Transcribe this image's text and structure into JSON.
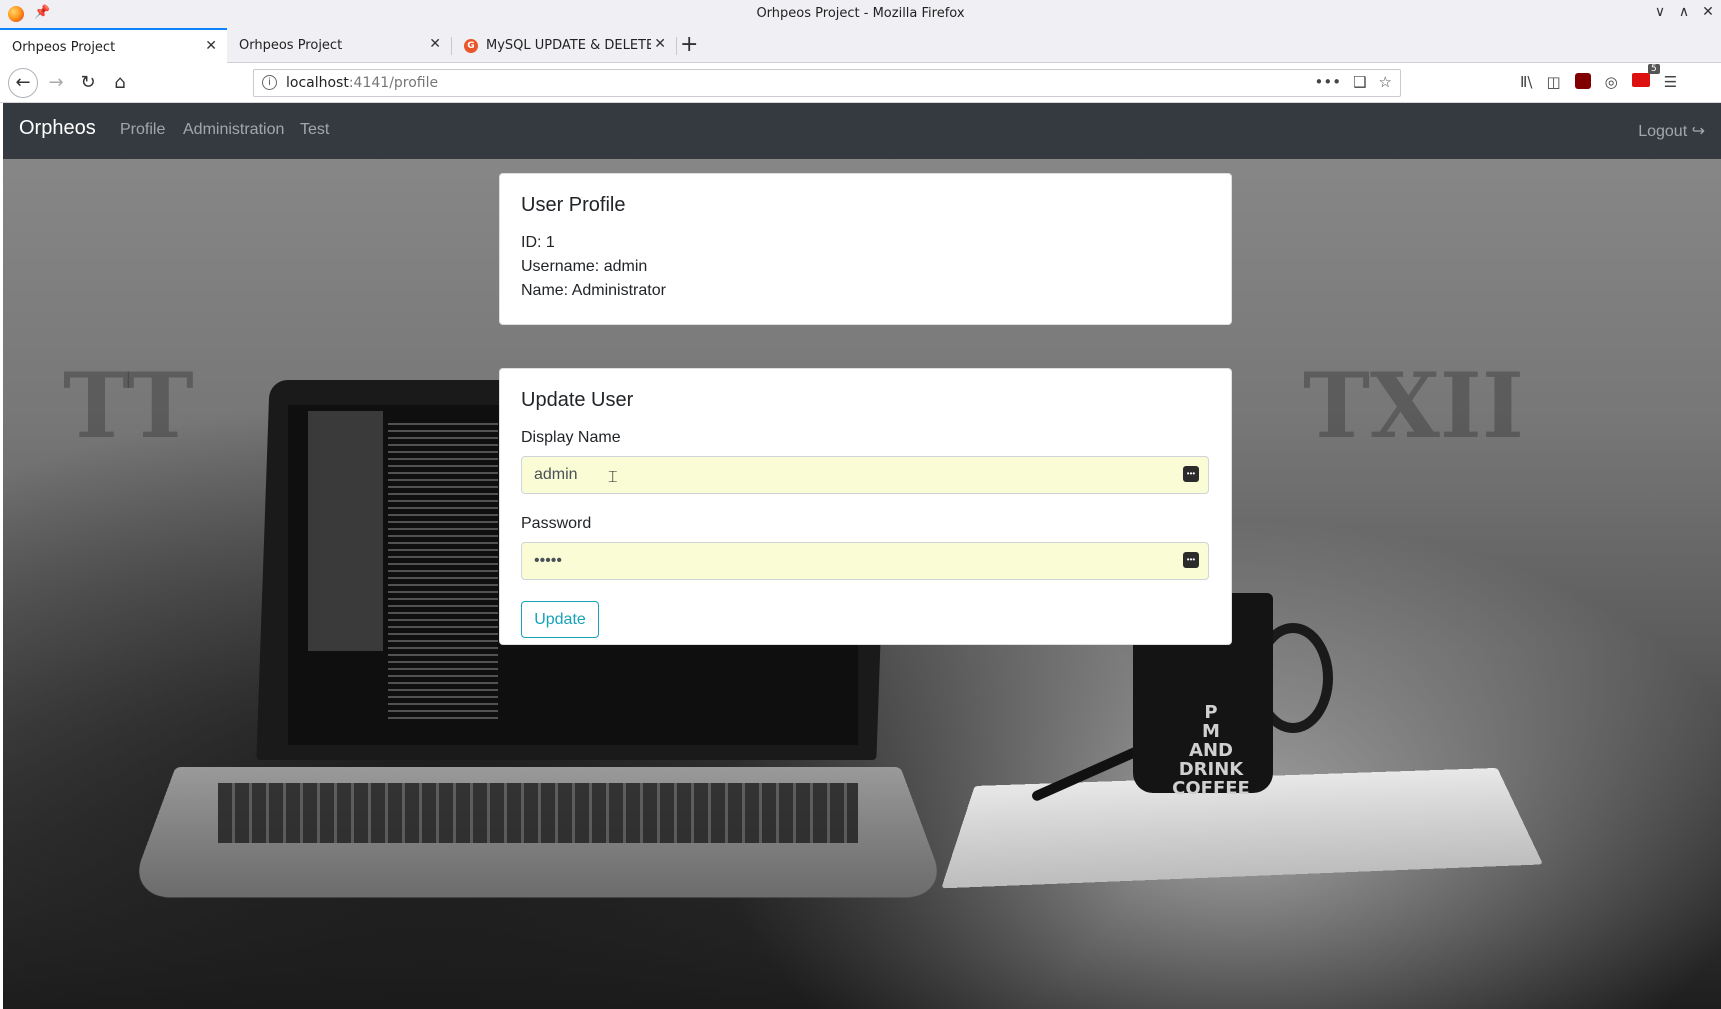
{
  "browser": {
    "window_title": "Orhpeos Project - Mozilla Firefox",
    "tabs": [
      {
        "label": "Orhpeos Project",
        "active": true
      },
      {
        "label": "Orhpeos Project",
        "active": false
      },
      {
        "label": "MySQL UPDATE & DELETE",
        "active": false
      }
    ],
    "url_host": "localhost",
    "url_path": ":4141/profile",
    "extension_badge": "5",
    "icons": {
      "back": "←",
      "forward": "→",
      "reload": "↻",
      "home": "⌂",
      "more": "•••",
      "pocket": "❑",
      "bookmark": "☆",
      "library": "Ⅱ\\",
      "sidebar": "◫",
      "menu": "☰",
      "close": "✕",
      "new_tab": "+",
      "minimize": "∨",
      "maximize": "∧",
      "info": "i"
    }
  },
  "app": {
    "brand": "Orpheos",
    "nav": [
      "Profile",
      "Administration",
      "Test"
    ],
    "logout": "Logout"
  },
  "profile_card": {
    "title": "User Profile",
    "id_line": "ID: 1",
    "username_line": "Username: admin",
    "name_line": "Name: Administrator"
  },
  "update_card": {
    "title": "Update User",
    "display_name_label": "Display Name",
    "display_name_value": "admin",
    "password_label": "Password",
    "password_value": "admin",
    "submit_label": "Update"
  },
  "background": {
    "mug_text": "P\nM\nAND\nDRINK\nCOFFEE",
    "carving_left": "TT",
    "carving_right": "TXII"
  }
}
